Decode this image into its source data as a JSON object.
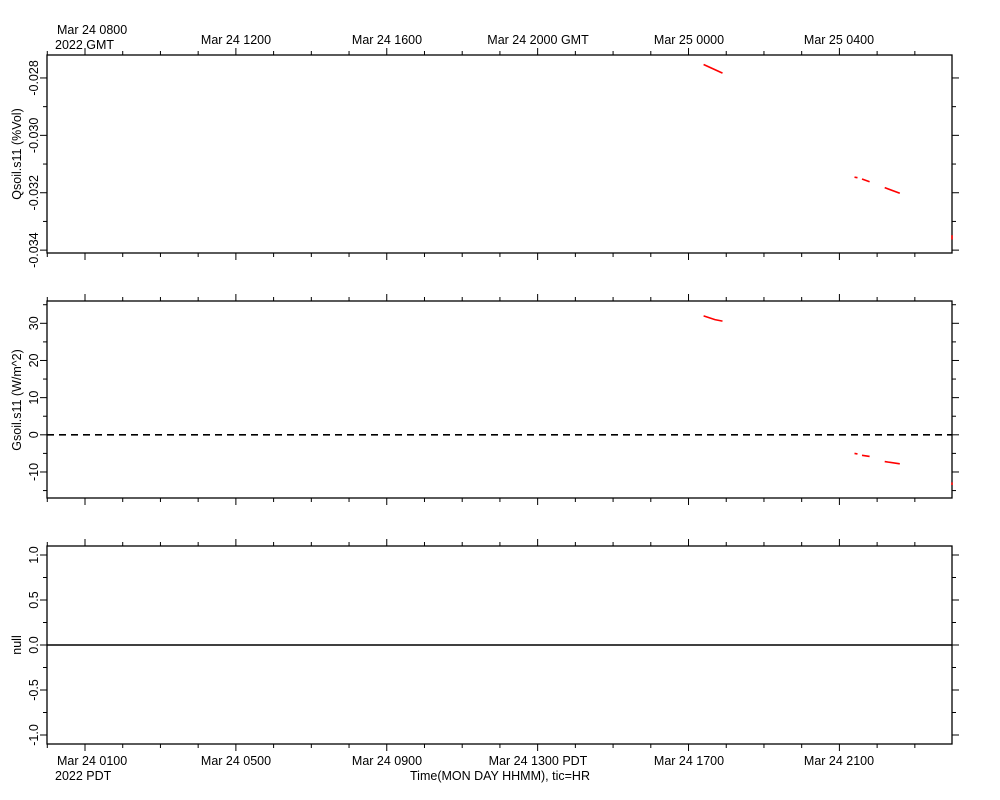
{
  "top_axis": {
    "first_label": [
      "Mar 24 0800",
      "2022 GMT"
    ],
    "labels": [
      "Mar 24 1200",
      "Mar 24 1600",
      "Mar 24 2000 GMT",
      "Mar 25 0000",
      "Mar 25 0400"
    ]
  },
  "bottom_axis": {
    "first_label": [
      "Mar 24 0100",
      "2022 PDT"
    ],
    "labels": [
      "Mar 24 0500",
      "Mar 24 0900",
      "Mar 24 1300 PDT",
      "Mar 24 1700",
      "Mar 24 2100"
    ],
    "title": "Time(MON DAY HHMM), tic=HR"
  },
  "colors": {
    "series": "#ff0000",
    "axis": "#000000"
  },
  "chart_data": [
    {
      "type": "line",
      "ylabel": "Qsoil.s11 (%Vol)",
      "x_unit": "hours after Mar 24 0800 GMT",
      "ylim": [
        -0.0341,
        -0.0272
      ],
      "yticks": [
        -0.028,
        -0.03,
        -0.032,
        -0.034
      ],
      "ytick_labels": [
        "-0.028",
        "-0.030",
        "-0.032",
        "-0.034"
      ],
      "series": [
        {
          "values": [
            [
              16.4,
              -0.02753
            ],
            [
              16.9,
              -0.02783
            ]
          ]
        },
        {
          "values": [
            [
              20.4,
              -0.03146
            ]
          ]
        },
        {
          "values": [
            [
              20.6,
              -0.03152
            ],
            [
              20.8,
              -0.03162
            ]
          ]
        },
        {
          "values": [
            [
              21.2,
              -0.03182
            ],
            [
              21.6,
              -0.03202
            ]
          ]
        },
        {
          "values": [
            [
              23.5,
              -0.03348
            ],
            [
              23.8,
              -0.03349
            ],
            [
              24.2,
              -0.03363
            ]
          ]
        }
      ]
    },
    {
      "type": "line",
      "ylabel": "Gsoil.s11 (W/m^2)",
      "x_unit": "hours after Mar 24 0800 GMT",
      "ylim": [
        -17,
        36
      ],
      "yticks": [
        30,
        20,
        10,
        0,
        -10
      ],
      "ytick_labels": [
        "30",
        "20",
        "10",
        "0",
        "-10"
      ],
      "zero_line": true,
      "series": [
        {
          "values": [
            [
              16.4,
              32
            ],
            [
              16.7,
              31
            ],
            [
              16.9,
              30.6
            ]
          ]
        },
        {
          "values": [
            [
              20.4,
              -5
            ]
          ]
        },
        {
          "values": [
            [
              20.6,
              -5.5
            ],
            [
              20.8,
              -5.8
            ]
          ]
        },
        {
          "values": [
            [
              21.2,
              -7.2
            ],
            [
              21.6,
              -7.8
            ]
          ]
        },
        {
          "values": [
            [
              23.5,
              -12.8
            ],
            [
              23.9,
              -13.2
            ],
            [
              24.2,
              -13.5
            ]
          ]
        }
      ]
    },
    {
      "type": "line",
      "ylabel": "null",
      "ylim": [
        -1.1,
        1.1
      ],
      "yticks": [
        1.0,
        0.5,
        0.0,
        -0.5,
        -1.0
      ],
      "ytick_labels": [
        "1.0",
        "0.5",
        "0.0",
        "-0.5",
        "-1.0"
      ],
      "series": [
        {
          "values": [
            [
              -1,
              0
            ],
            [
              24.4,
              0
            ]
          ]
        }
      ]
    }
  ]
}
